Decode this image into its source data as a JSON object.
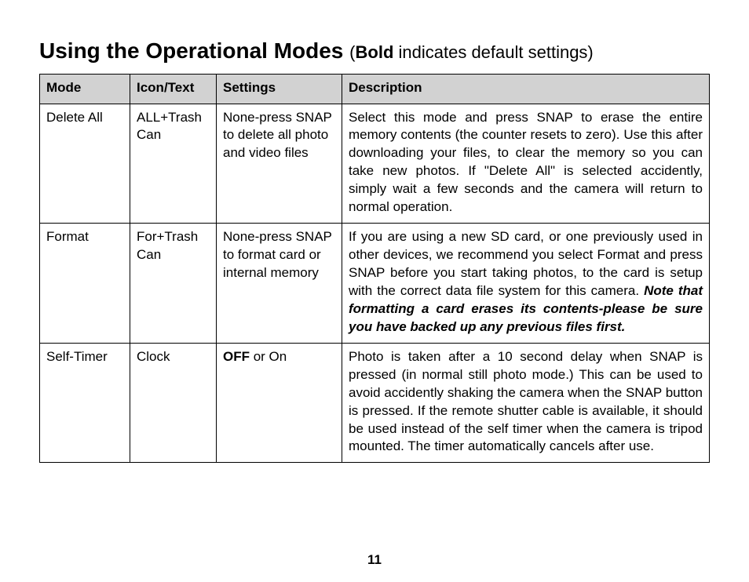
{
  "title": {
    "main": "Using the Operational Modes",
    "note_prefix": "(",
    "note_bold": "Bold",
    "note_suffix": " indicates default settings)"
  },
  "headers": {
    "mode": "Mode",
    "icon": "Icon/Text",
    "settings": "Settings",
    "description": "Description"
  },
  "rows": [
    {
      "mode": "Delete All",
      "icon": "ALL+Trash Can",
      "settings_plain": "None-press SNAP to delete all photo and video files",
      "desc_plain": "Select this mode and press SNAP to erase the entire memory contents (the counter resets to zero). Use this after downloading your files, to clear the memory so you can take new photos. If \"Delete All\" is selected accidently, simply wait a few seconds and the camera will return to normal operation."
    },
    {
      "mode": "Format",
      "icon": "For+Trash Can",
      "settings_plain": "None-press SNAP to format card or internal memory",
      "desc_lead": "If you are using a new SD card, or one previously used in other devices, we recommend you select Format and press SNAP before you start taking photos, to the card is setup with the correct data file system for this camera. ",
      "desc_emph": "Note that formatting a card erases its contents-please be sure you have backed up any previous files first."
    },
    {
      "mode": "Self-Timer",
      "icon": "Clock",
      "settings_bold": "OFF",
      "settings_rest": " or On",
      "desc_plain": "Photo is taken after a 10 second delay when SNAP is pressed (in normal still photo mode.) This can be used to avoid accidently shaking the camera when the SNAP button is pressed. If the remote shutter cable is available, it should be used instead of the self timer when the camera is tripod mounted. The timer automatically cancels after use."
    }
  ],
  "page_number": "11"
}
